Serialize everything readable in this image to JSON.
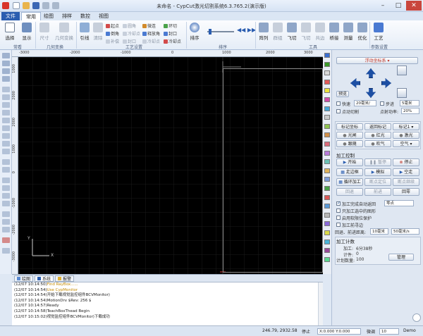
{
  "window": {
    "title": "未命名 - CypCut激光切割系统6.3.765.2(演示版)",
    "min": "–",
    "max": "□",
    "close": "✕"
  },
  "tabs": [
    "文件",
    "常用",
    "绘图",
    "排样",
    "数控",
    "视图"
  ],
  "ribbon": {
    "big": [
      {
        "label": "选择",
        "icon": "cursor-icon"
      },
      {
        "label": "显示",
        "icon": "display-icon"
      },
      {
        "label": "尺寸",
        "icon": "size-icon"
      },
      {
        "label": "几何变换",
        "icon": "transform-icon"
      },
      {
        "label": "引线",
        "icon": "lead-line-icon"
      },
      {
        "label": "清除",
        "icon": "clear-icon"
      },
      {
        "label": "排序",
        "icon": "sort-icon"
      },
      {
        "label": "阵列",
        "icon": "array-icon"
      },
      {
        "label": "群组",
        "icon": "group-icon"
      },
      {
        "label": "飞切",
        "icon": "fly-cut-icon"
      },
      {
        "label": "共边",
        "icon": "common-edge-icon"
      },
      {
        "label": "桥接",
        "icon": "bridge-icon"
      },
      {
        "label": "测量",
        "icon": "measure-icon"
      },
      {
        "label": "优化",
        "icon": "optimize-icon"
      },
      {
        "label": "工艺",
        "icon": "process-icon"
      }
    ],
    "small": {
      "c1": [
        "起点",
        "倒角",
        "补偿"
      ],
      "c2": [
        "圆角",
        "冷却点",
        "封口"
      ],
      "c3": [
        "微连",
        "释放角",
        "冷却点"
      ],
      "c4": [
        "环切",
        "封口",
        "冷却点"
      ]
    },
    "groups": [
      "常看",
      "几何变换",
      "工艺设置",
      "排序",
      "工具",
      "参数设置"
    ]
  },
  "rulers": {
    "top": [
      "-3000",
      "-2000",
      "-1000",
      "0",
      "1000",
      "2000",
      "3000"
    ],
    "left": [
      "1000",
      "2000",
      "2000",
      "1000",
      "0",
      "-1000",
      "-2000",
      "-3000"
    ]
  },
  "canvas": {
    "axis_x": "X",
    "axis_y": "Y"
  },
  "log": {
    "tabs": [
      "绘图",
      "系统",
      "报警"
    ],
    "lines": [
      {
        "time": "(12/07 10:14:50)",
        "text": "Find RayBox......",
        "color": "#c48a00"
      },
      {
        "time": "(12/07 10:14:54)",
        "text": "Use CypMonitor",
        "color": "#c48a00"
      },
      {
        "time": "(12/07 10:14:54)",
        "text": "开始下载视觉监控组件BCVMonitor)",
        "color": "#222"
      },
      {
        "time": "(12/07 10:14:54)",
        "text": "MotionDrv $Rev: 256 $",
        "color": "#222"
      },
      {
        "time": "(12/07 10:14:57)",
        "text": "Ready",
        "color": "#222"
      },
      {
        "time": "(12/07 10:14:58)",
        "text": "TeachBoxThead Begin",
        "color": "#222"
      },
      {
        "time": "(12/07 10:15:02)",
        "text": "视觉监控组件BCVMonitor)下载成功",
        "color": "#222"
      }
    ]
  },
  "colors": [
    "#3a6fd0",
    "#3c9a2b",
    "#d8d8d8",
    "#e35a5a",
    "#ece23a",
    "#d24aa8",
    "#44a6d8",
    "#c9c9c9",
    "#8fc451",
    "#cf8f4a",
    "#d96a7a",
    "#b97ad9",
    "#6bc1b5",
    "#e0b25a",
    "#7a9ad9",
    "#4aa24a",
    "#d95a5a",
    "#5a9ad9",
    "#b5b5b5",
    "#8a6ad9",
    "#d9d94a",
    "#4ab5d9",
    "#9a4a9a",
    "#5ad98f"
  ],
  "panel": {
    "float": "浮动坐标系",
    "jog": "预览",
    "fast_label": "快速",
    "fast_val": "20毫米/",
    "step_label": "步进",
    "step_val": "5毫米",
    "spot_label": "点动切割",
    "spot_power_label": "点射功率:",
    "spot_power_val": "20%",
    "mark": "标记坐标",
    "back": "返回标记",
    "mark_sel": "标记1",
    "light": "光闸",
    "red": "红光",
    "laser": "激光",
    "follow": "跟随",
    "blow": "吹气",
    "air": "空气",
    "ctrl_title": "加工控制",
    "start": "开始",
    "pause": "暂停",
    "stop": "停止",
    "frame": "走边框",
    "sim": "模拟",
    "empty": "空走",
    "loop": "循环加工",
    "bp_pos": "断点定位",
    "bp_cont": "断点继续",
    "back2": "回退",
    "fwd": "前进",
    "home": "回零",
    "opt1": "加工完成自动返回",
    "opt1_sel": "零点",
    "opt2": "只加工选中的图形",
    "opt3": "启用软限位保护",
    "opt4": "加工前寻边",
    "dist_label": "回退、前进距离:",
    "dist1": "10毫米",
    "dist2": "50毫米/s",
    "count_title": "加工计数",
    "time_label": "加工:",
    "time_val": "6分38秒",
    "pieces_label": "计件:",
    "pieces_val": "0",
    "plan_label": "计划数量:",
    "plan_val": "100",
    "manage": "管理"
  },
  "status": {
    "coords": "246.79, 2932.58",
    "state": "停止",
    "xy": "X:0.000 Y:0.000",
    "fine": "微调",
    "step": "10",
    "demo": "Demo"
  }
}
